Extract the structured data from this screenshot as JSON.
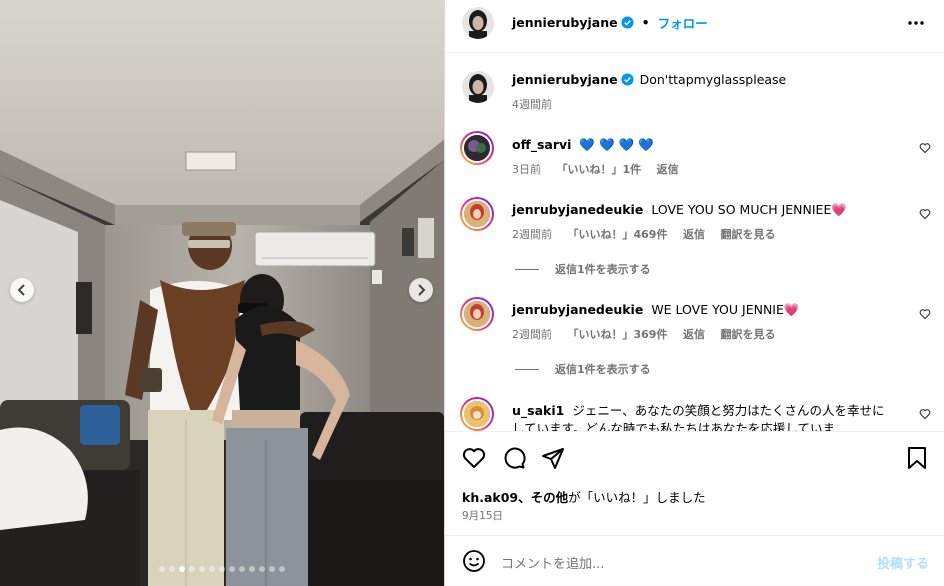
{
  "post": {
    "username": "jennierubyjane",
    "follow_label": "フォロー",
    "separator": "•",
    "caption_text": "Don'ttapmyglassplease",
    "caption_time": "4週間前"
  },
  "carousel": {
    "total_images": 13,
    "active_index": 2
  },
  "comments": [
    {
      "username": "off_sarvi",
      "text": "💙 💙 💙 💙",
      "time": "3日前",
      "likes": "「いいね！」1件",
      "reply": "返信",
      "translate": ""
    },
    {
      "username": "jenrubyjanedeukie",
      "text": "LOVE YOU SO MUCH JENNIEE💗",
      "time": "2週間前",
      "likes": "「いいね！」469件",
      "reply": "返信",
      "translate": "翻訳を見る",
      "replies_label": "返信1件を表示する"
    },
    {
      "username": "jenrubyjanedeukie",
      "text": "WE LOVE YOU JENNIE💗",
      "time": "2週間前",
      "likes": "「いいね！」369件",
      "reply": "返信",
      "translate": "翻訳を見る",
      "replies_label": "返信1件を表示する"
    },
    {
      "username": "u_saki1",
      "text": "ジェニー、あなたの笑顔と努力はたくさんの人を幸せにしています。どんな時でも私たちはあなたを応援していま"
    }
  ],
  "likes_line": {
    "user": "kh.ak09",
    "others": "、その他",
    "suffix": "が「いいね！」しました"
  },
  "post_date": "9月15日",
  "composer": {
    "placeholder": "コメントを追加...",
    "post_label": "投稿する"
  },
  "icons": {
    "verified": "verified-badge-icon",
    "more": "more-options-icon",
    "heart": "heart-icon",
    "comment": "comment-icon",
    "share": "share-icon",
    "bookmark": "bookmark-icon",
    "emoji": "emoji-icon",
    "prev": "chevron-left-icon",
    "next": "chevron-right-icon"
  },
  "colors": {
    "link_blue": "#0095f6",
    "post_disabled": "#b2dffc",
    "verified": "#0095f6",
    "meta_gray": "#737373"
  }
}
